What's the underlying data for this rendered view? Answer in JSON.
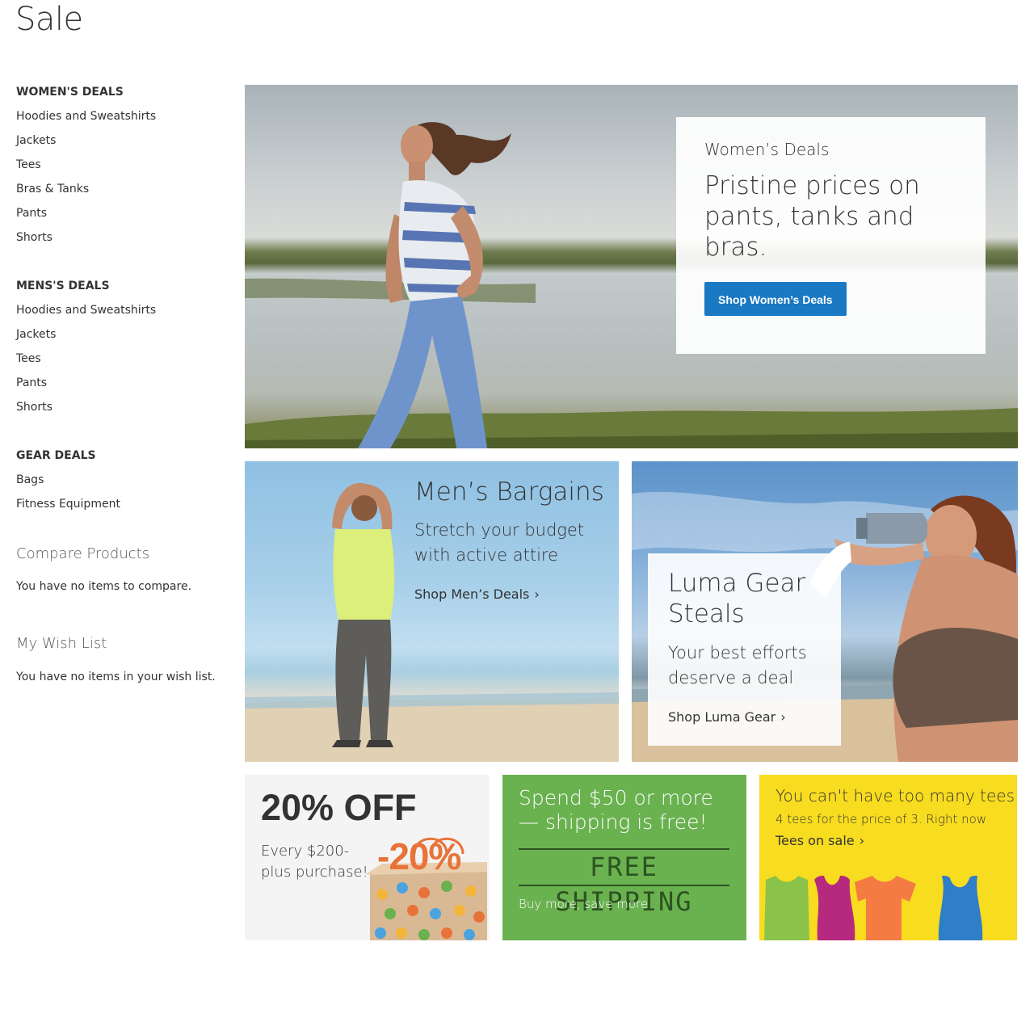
{
  "page": {
    "title": "Sale"
  },
  "sidebar": {
    "groups": [
      {
        "heading": "WOMEN'S DEALS",
        "items": [
          "Hoodies and Sweatshirts",
          "Jackets",
          "Tees",
          "Bras & Tanks",
          "Pants",
          "Shorts"
        ]
      },
      {
        "heading": "MENS'S DEALS",
        "items": [
          "Hoodies and Sweatshirts",
          "Jackets",
          "Tees",
          "Pants",
          "Shorts"
        ]
      },
      {
        "heading": "GEAR DEALS",
        "items": [
          "Bags",
          "Fitness Equipment"
        ]
      }
    ],
    "compare": {
      "title": "Compare Products",
      "text": "You have no items to compare."
    },
    "wishlist": {
      "title": "My Wish List",
      "text": "You have no items in your wish list."
    }
  },
  "banners": {
    "women": {
      "subtitle": "Women’s Deals",
      "headline": "Pristine prices on pants, tanks and bras.",
      "button": "Shop Women’s Deals"
    },
    "men": {
      "headline": "Men’s Bargains",
      "subtitle": "Stretch your budget with active attire",
      "link": "Shop Men’s Deals"
    },
    "gear": {
      "headline": "Luma Gear Steals",
      "subtitle": "Your best efforts deserve a deal",
      "link": "Shop Luma Gear"
    },
    "off": {
      "headline": "20% OFF",
      "subtitle": "Every $200-plus purchase!",
      "tag": "-20%"
    },
    "shipping": {
      "headline": "Spend $50 or more — shipping is free!",
      "big": "FREE SHIPPING",
      "subtitle": "Buy more, save more"
    },
    "tees": {
      "headline": "You can't have too many tees",
      "subtitle": "4 tees for the price of 3. Right now",
      "link": "Tees on sale"
    }
  },
  "colors": {
    "primary_button": "#1979c3",
    "shipping_bg": "#6ab150",
    "tees_bg": "#f8dc1f",
    "off_bg": "#f4f4f4",
    "tag_orange": "#e8733a"
  },
  "icons": {
    "link_chevron": "chevron-right-icon"
  }
}
